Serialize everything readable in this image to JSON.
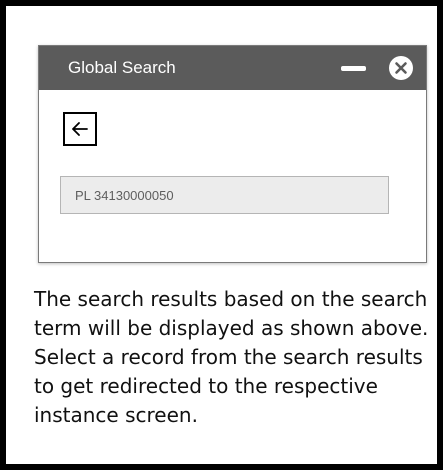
{
  "window": {
    "title": "Global Search",
    "minimize_icon": "minimize-icon",
    "close_icon": "close-circle-icon"
  },
  "back_button": {
    "icon": "arrow-left-icon"
  },
  "search": {
    "value": "PL 34130000050"
  },
  "caption": {
    "text": "The search results based on the search term will be displayed as shown above. Select a record from the search results to get redirected to the respective instance screen."
  },
  "colors": {
    "titlebar": "#5b5b5b",
    "frame_border": "#000000",
    "input_background": "#ececec"
  }
}
